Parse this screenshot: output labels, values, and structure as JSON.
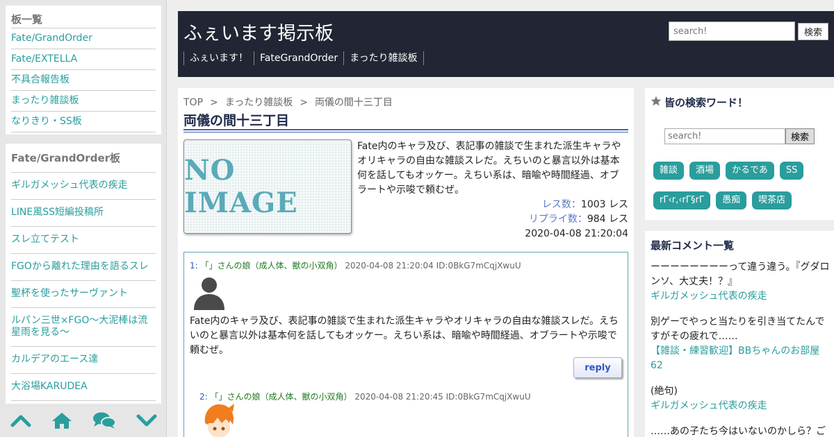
{
  "sidebar": {
    "boards_title": "板一覧",
    "boards": [
      "Fate/GrandOrder",
      "Fate/EXTELLA",
      "不具合報告板",
      "まったり雑談板",
      "なりきり・SS板"
    ],
    "fgo_title": "Fate/GrandOrder板",
    "fgo_threads": [
      "ギルガメッシュ代表の疾走",
      "LINE風SS短編投稿所",
      "スレ立てテスト",
      "FGOから離れた理由を語るスレ",
      "聖杯を使ったサーヴァント",
      "ルパン三世×FGO～大泥棒は流星雨を見る～",
      "カルデアのエース達",
      "大浴場KARUDEA"
    ],
    "bottom_icons": [
      "chevron-up-icon",
      "home-icon",
      "chat-icon",
      "chevron-down-icon"
    ]
  },
  "header": {
    "title": "ふぇいます掲示板",
    "nav": [
      "ふぇいます！",
      "FateGrandOrder",
      "まったり雑談板"
    ],
    "search_placeholder": "search!",
    "search_button": "検索"
  },
  "main": {
    "breadcrumb": [
      "TOP",
      "まったり雑談板",
      "両儀の間十三丁目"
    ],
    "breadcrumb_sep": ">",
    "thread_title": "両儀の間十三丁目",
    "no_image": "NO IMAGE",
    "description": "Fate内のキャラ及び、表記事の雑談で生まれた派生キャラやオリキャラの自由な雑談スレだ。えちいのと暴言以外は基本何を話してもオッケー。えちい系は、暗喩や時間経過、オブラートや示唆で頼むぜ。",
    "res_label": "レス数：",
    "res_value": "1003 レス",
    "reply_label": "リプライ数：",
    "reply_value": "984 レス",
    "date": "2020-04-08 21:20:04",
    "comments": [
      {
        "num": "1:",
        "name": "「」さんの娘（成人体、獣の小双角）",
        "meta": "2020-04-08 21:20:04 ID:0BkG7mCqjXwuU",
        "body": "Fate内のキャラ及び、表記事の雑談で生まれた派生キャラやオリキャラの自由な雑談スレだ。えちいのと暴言以外は基本何を話してもオッケー。えちい系は、暗喩や時間経過、オブラートや示唆で頼むぜ。",
        "reply_label": "reply"
      },
      {
        "num": "2:",
        "name": "「」さんの娘（成人体、獣の小双角）",
        "meta": "2020-04-08 21:20:45 ID:0BkG7mCqjXwuU"
      }
    ]
  },
  "right": {
    "search_title": "皆の検索ワード！",
    "search_placeholder": "search!",
    "search_button": "検索",
    "tags": [
      "雑談",
      "酒場",
      "かるであ",
      "SS",
      "rΓ‹r‚‹rΓ§rΓ",
      "愚痴",
      "喫茶店"
    ],
    "recent_title": "最新コメント一覧",
    "recent": [
      {
        "text": "ーーーーーーーーって違う違う。『グダロンソ、大丈夫！？』",
        "thread": "ギルガメッシュ代表の疾走"
      },
      {
        "text": "別ゲーでやっと当たりを引き当てたんですがその疲れで……",
        "thread": "【雑談・練習歓迎】BBちゃんのお部屋62"
      },
      {
        "text": "(絶句)",
        "thread": "ギルガメッシュ代表の疾走"
      },
      {
        "text": "……あの子たち今はいないのかしら？ご",
        "thread": ""
      }
    ]
  },
  "colors": {
    "accent": "#2a9d9d",
    "header_bg": "#222533",
    "link_blue": "#2f57c6",
    "name_green": "#1f7a1f"
  }
}
